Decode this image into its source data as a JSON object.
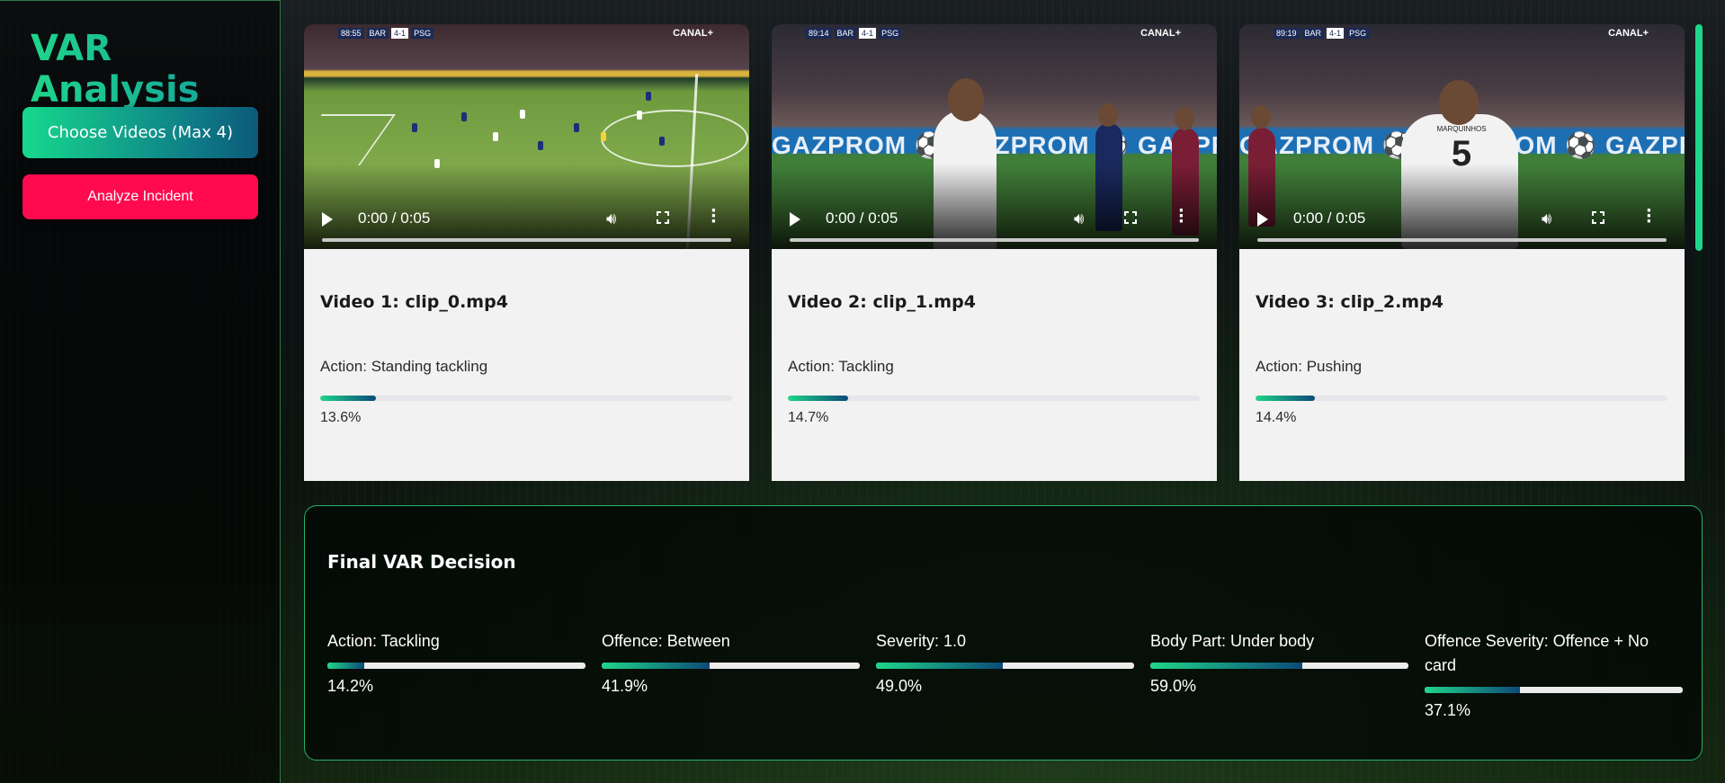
{
  "app": {
    "title": "VAR Analysis",
    "choose_label": "Choose Videos (Max 4)",
    "analyze_label": "Analyze Incident"
  },
  "videos": [
    {
      "title": "Video 1: clip_0.mp4",
      "action": "Action: Standing tackling",
      "confidence": 13.6,
      "confidence_label": "13.6%",
      "time": "0:00 / 0:05",
      "hud": {
        "clock": "88:55",
        "home": "BAR",
        "score": "4-1",
        "away": "PSG"
      },
      "broadcaster": "CANAL+"
    },
    {
      "title": "Video 2: clip_1.mp4",
      "action": "Action: Tackling",
      "confidence": 14.7,
      "confidence_label": "14.7%",
      "time": "0:00 / 0:05",
      "hud": {
        "clock": "89:14",
        "home": "BAR",
        "score": "4-1",
        "away": "PSG"
      },
      "broadcaster": "CANAL+",
      "banner": "GAZPROM ⚽ GAZPROM ⚽ GAZPROM"
    },
    {
      "title": "Video 3: clip_2.mp4",
      "action": "Action: Pushing",
      "confidence": 14.4,
      "confidence_label": "14.4%",
      "time": "0:00 / 0:05",
      "hud": {
        "clock": "89:19",
        "home": "BAR",
        "score": "4-1",
        "away": "PSG"
      },
      "broadcaster": "CANAL+",
      "banner": "GAZPROM ⚽ GAZPROM ⚽ GAZPROM",
      "jersey_name": "MARQUINHOS",
      "jersey_number": "5"
    }
  ],
  "decision": {
    "title": "Final VAR Decision",
    "metrics": [
      {
        "label": "Action: Tackling",
        "value": 14.2,
        "value_label": "14.2%"
      },
      {
        "label": "Offence: Between",
        "value": 41.9,
        "value_label": "41.9%"
      },
      {
        "label": "Severity: 1.0",
        "value": 49.0,
        "value_label": "49.0%"
      },
      {
        "label": "Body Part: Under body",
        "value": 59.0,
        "value_label": "59.0%"
      },
      {
        "label": "Offence Severity: Offence + No card",
        "value": 37.1,
        "value_label": "37.1%"
      }
    ]
  },
  "colors": {
    "accent_green": "#1fd58a",
    "accent_blue": "#0c4a78",
    "analyze_red": "#ff0a4e",
    "border_green": "#27b06a"
  },
  "icons": {
    "play": "play-icon",
    "volume": "volume-icon",
    "fullscreen": "fullscreen-icon",
    "more": "more-options-icon"
  }
}
